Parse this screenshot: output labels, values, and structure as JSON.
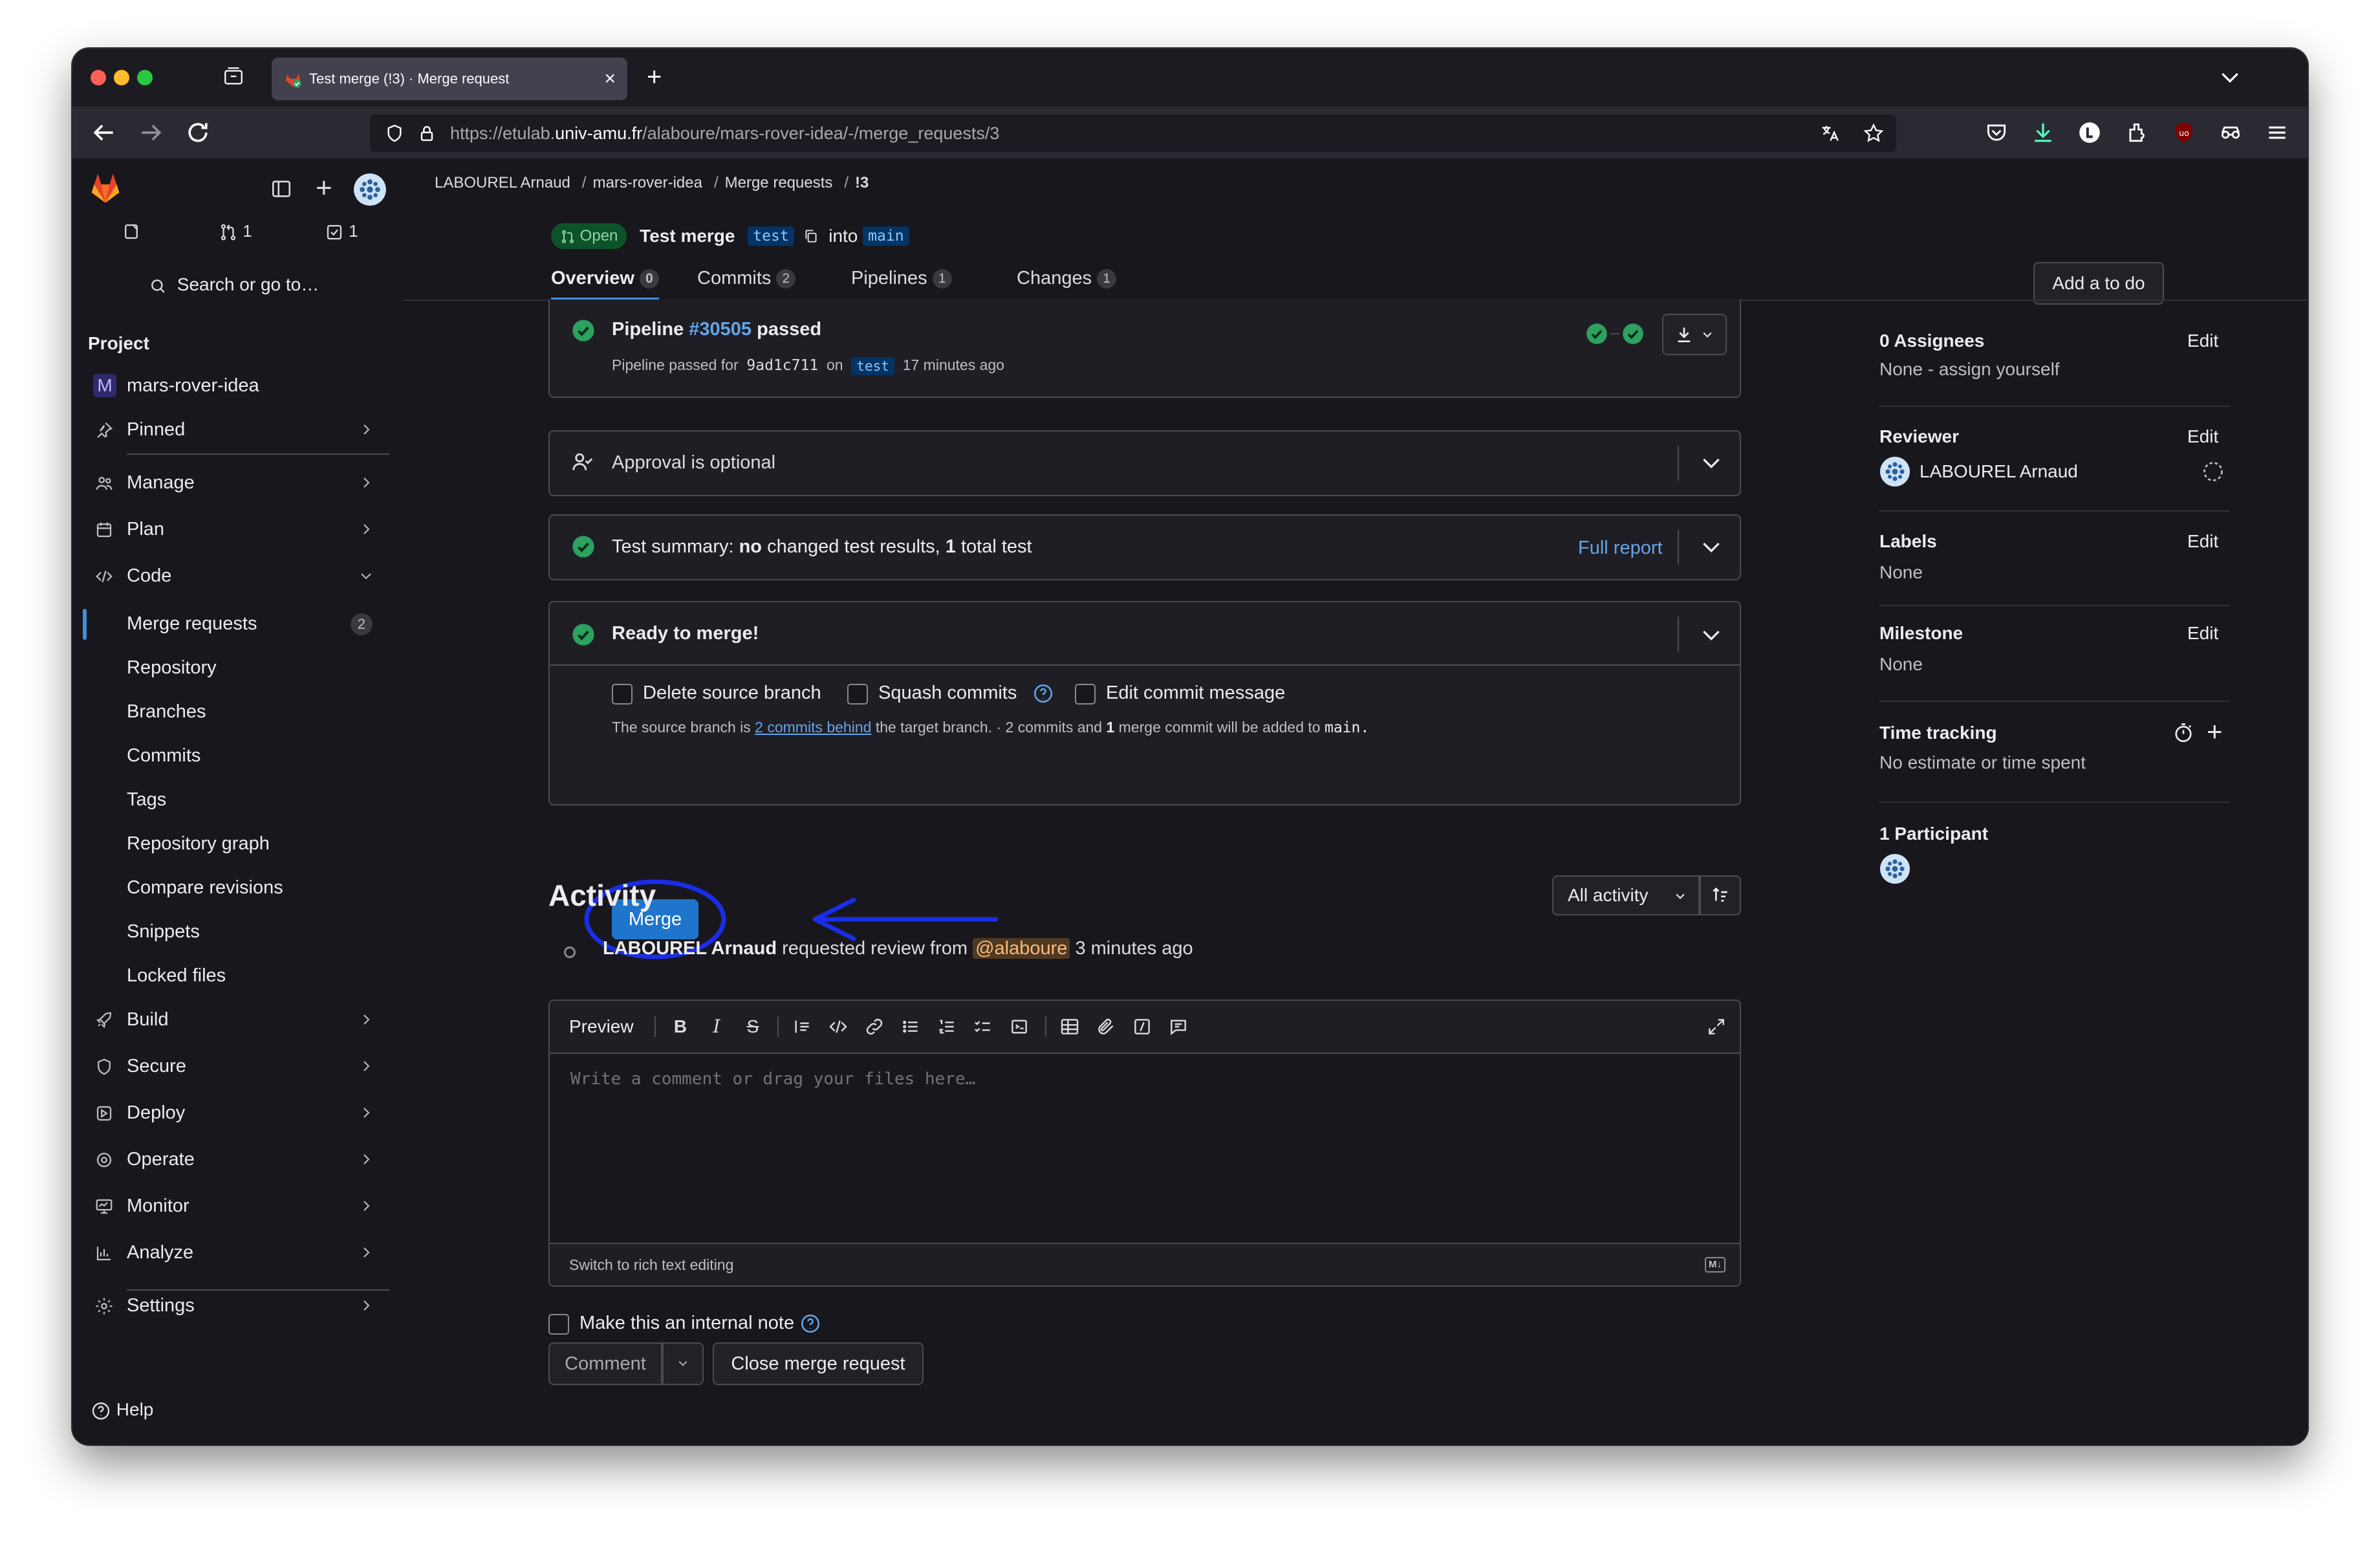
{
  "browser": {
    "tab_title": "Test merge (!3) · Merge request",
    "url_prefix": "https://etulab.",
    "url_host": "univ-amu.fr",
    "url_path": "/alaboure/mars-rover-idea/-/merge_requests/3"
  },
  "sidebar": {
    "counts": {
      "merge_requests": "1",
      "todos": "1"
    },
    "search_label": "Search or go to…",
    "section_title": "Project",
    "project_avatar": "M",
    "project_name": "mars-rover-idea",
    "pinned": "Pinned",
    "items": {
      "manage": "Manage",
      "plan": "Plan",
      "code": "Code",
      "build": "Build",
      "secure": "Secure",
      "deploy": "Deploy",
      "operate": "Operate",
      "monitor": "Monitor",
      "analyze": "Analyze",
      "settings": "Settings"
    },
    "code_sub": {
      "merge_requests": "Merge requests",
      "merge_requests_count": "2",
      "repository": "Repository",
      "branches": "Branches",
      "commits": "Commits",
      "tags": "Tags",
      "repository_graph": "Repository graph",
      "compare_revisions": "Compare revisions",
      "snippets": "Snippets",
      "locked_files": "Locked files"
    },
    "help": "Help"
  },
  "breadcrumb": [
    "LABOUREL Arnaud",
    "mars-rover-idea",
    "Merge requests",
    "!3"
  ],
  "mr": {
    "status": "Open",
    "title": "Test merge",
    "source_branch": "test",
    "into": "into",
    "target_branch": "main",
    "tabs": {
      "overview": "Overview",
      "overview_count": "0",
      "commits": "Commits",
      "commits_count": "2",
      "pipelines": "Pipelines",
      "pipelines_count": "1",
      "changes": "Changes",
      "changes_count": "1"
    },
    "add_todo": "Add a to do"
  },
  "widgets": {
    "pipeline": {
      "prefix": "Pipeline",
      "id": "#30505",
      "status": "passed",
      "sub_prefix": "Pipeline passed for",
      "commit": "9ad1c711",
      "on": "on",
      "branch": "test",
      "time": "17 minutes ago"
    },
    "approval": "Approval is optional",
    "test_summary": {
      "prefix": "Test summary:",
      "no": "no",
      "middle": "changed test results,",
      "count": "1",
      "suffix": "total test",
      "full_report": "Full report"
    },
    "ready": {
      "title": "Ready to merge!",
      "delete_source": "Delete source branch",
      "squash": "Squash commits",
      "edit_message": "Edit commit message",
      "info_prefix": "The source branch is",
      "info_link": "2 commits behind",
      "info_mid": "the target branch. · 2 commits and",
      "info_count": "1",
      "info_mid2": "merge commit will be added to",
      "info_branch": "main.",
      "merge_button": "Merge"
    }
  },
  "activity": {
    "title": "Activity",
    "filter": "All activity",
    "note": {
      "author": "LABOUREL Arnaud",
      "action": "requested review from",
      "mention": "@alaboure",
      "time": "3 minutes ago"
    },
    "editor": {
      "preview": "Preview",
      "placeholder": "Write a comment or drag your files here…",
      "switch": "Switch to rich text editing",
      "md_badge": "M↓"
    },
    "internal_note": "Make this an internal note",
    "comment": "Comment",
    "close_mr": "Close merge request"
  },
  "right_sidebar": {
    "assignees_label": "0 Assignees",
    "assignees_value": "None - assign yourself",
    "reviewer_label": "Reviewer",
    "reviewer_name": "LABOUREL Arnaud",
    "labels_label": "Labels",
    "labels_value": "None",
    "milestone_label": "Milestone",
    "milestone_value": "None",
    "time_label": "Time tracking",
    "time_value": "No estimate or time spent",
    "participants_label": "1 Participant",
    "edit": "Edit"
  },
  "annotation_color": "#1a2de8"
}
